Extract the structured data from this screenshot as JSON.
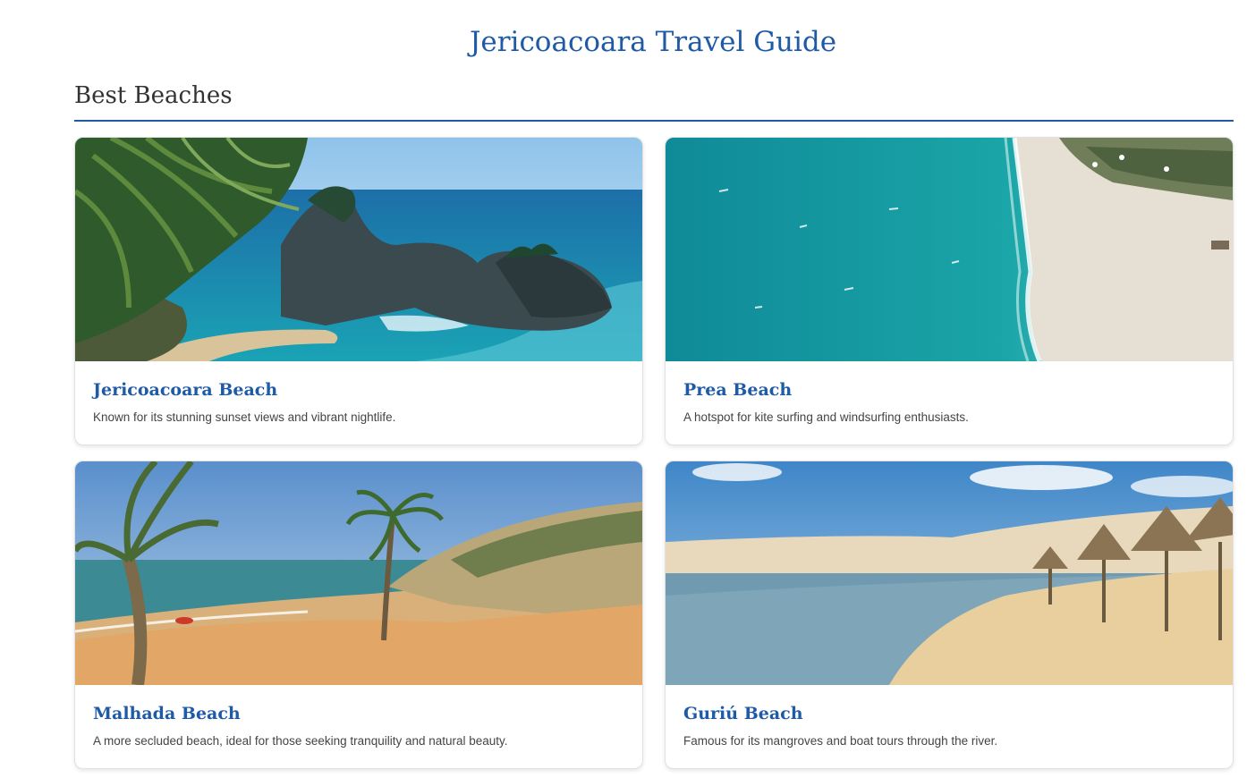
{
  "page": {
    "title": "Jericoacoara Travel Guide"
  },
  "section": {
    "heading": "Best Beaches"
  },
  "beaches": [
    {
      "name": "Jericoacoara Beach",
      "description": "Known for its stunning sunset views and vibrant nightlife.",
      "image": "rocky-coast-with-palm-photo"
    },
    {
      "name": "Prea Beach",
      "description": "A hotspot for kite surfing and windsurfing enthusiasts.",
      "image": "aerial-turquoise-sea-and-sand-photo"
    },
    {
      "name": "Malhada Beach",
      "description": "A more secluded beach, ideal for those seeking tranquility and natural beauty.",
      "image": "beach-with-palms-and-dunes-photo"
    },
    {
      "name": "Guriú Beach",
      "description": "Famous for its mangroves and boat tours through the river.",
      "image": "lagoon-dunes-and-thatched-umbrellas-photo"
    }
  ],
  "colors": {
    "accent": "#1f5aa6",
    "text": "#333333"
  }
}
